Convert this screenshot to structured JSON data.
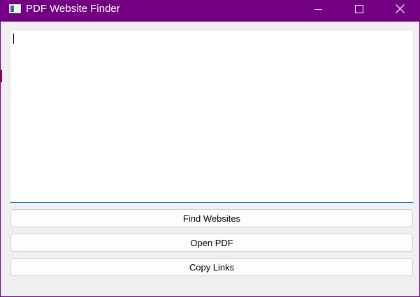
{
  "window": {
    "title": "PDF Website Finder",
    "icon": "app-window-icon",
    "accent_color": "#730082"
  },
  "caption_buttons": {
    "minimize_icon": "minimize-icon",
    "maximize_icon": "maximize-icon",
    "close_icon": "close-icon"
  },
  "editor": {
    "value": "",
    "placeholder": ""
  },
  "buttons": {
    "find_websites": "Find Websites",
    "open_pdf": "Open PDF",
    "copy_links": "Copy Links"
  }
}
